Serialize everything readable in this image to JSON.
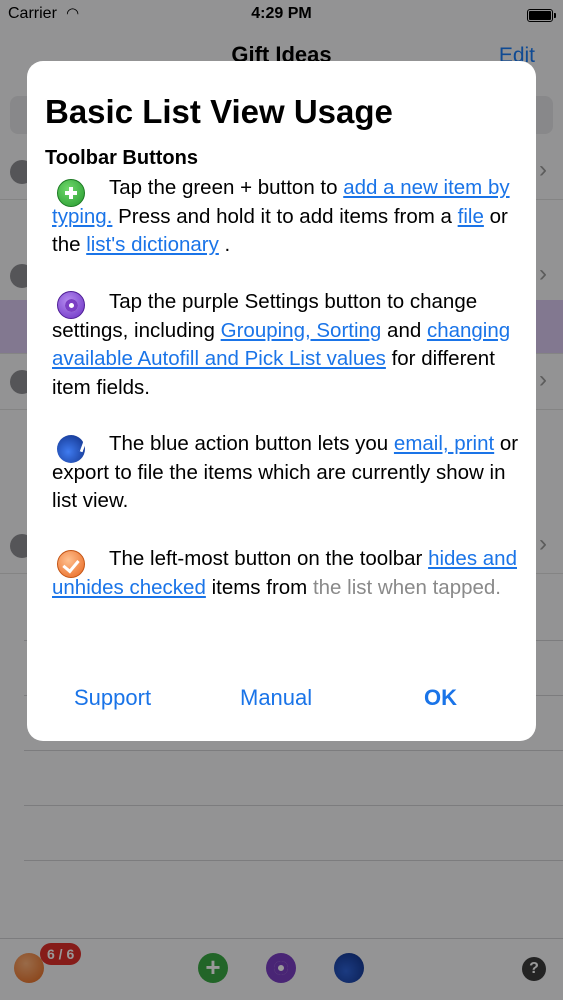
{
  "status_bar": {
    "carrier": "Carrier",
    "time": "4:29 PM"
  },
  "nav": {
    "title": "Gift Ideas",
    "edit_label": "Edit"
  },
  "toolbar": {
    "badge": "6 / 6",
    "help": "?"
  },
  "dialog": {
    "title": "Basic List View Usage",
    "subtitle": "Toolbar Buttons",
    "p1": {
      "t1": "Tap the green + button to ",
      "link1": "add a new item by typing.",
      "t2": " Press and hold it to add items from a ",
      "link2": "file",
      "t3": " or the ",
      "link3": "list's dictionary",
      "t4": " ."
    },
    "p2": {
      "t1": "Tap the purple Settings button to change settings, including ",
      "link1": "Grouping, Sorting",
      "t2": " and ",
      "link2": "changing available Autofill and Pick List values",
      "t3": " for different item fields."
    },
    "p3": {
      "t1": "The blue action button lets you ",
      "link1": "email, print",
      "t2": " or export to file the items which are currently show in list view."
    },
    "p4": {
      "t1": "The left-most button on the toolbar ",
      "link1": "hides and unhides checked",
      "t2": " items from ",
      "t3": "the list when tapped."
    },
    "buttons": {
      "support": "Support",
      "manual": "Manual",
      "ok": "OK"
    }
  },
  "colors": {
    "link": "#1a74e8",
    "dim_overlay": "rgba(0,0,0,0.40)"
  },
  "icons": [
    "add-icon",
    "settings-icon",
    "action-icon",
    "hide-checked-icon",
    "help-icon",
    "wifi-icon",
    "battery-icon"
  ]
}
